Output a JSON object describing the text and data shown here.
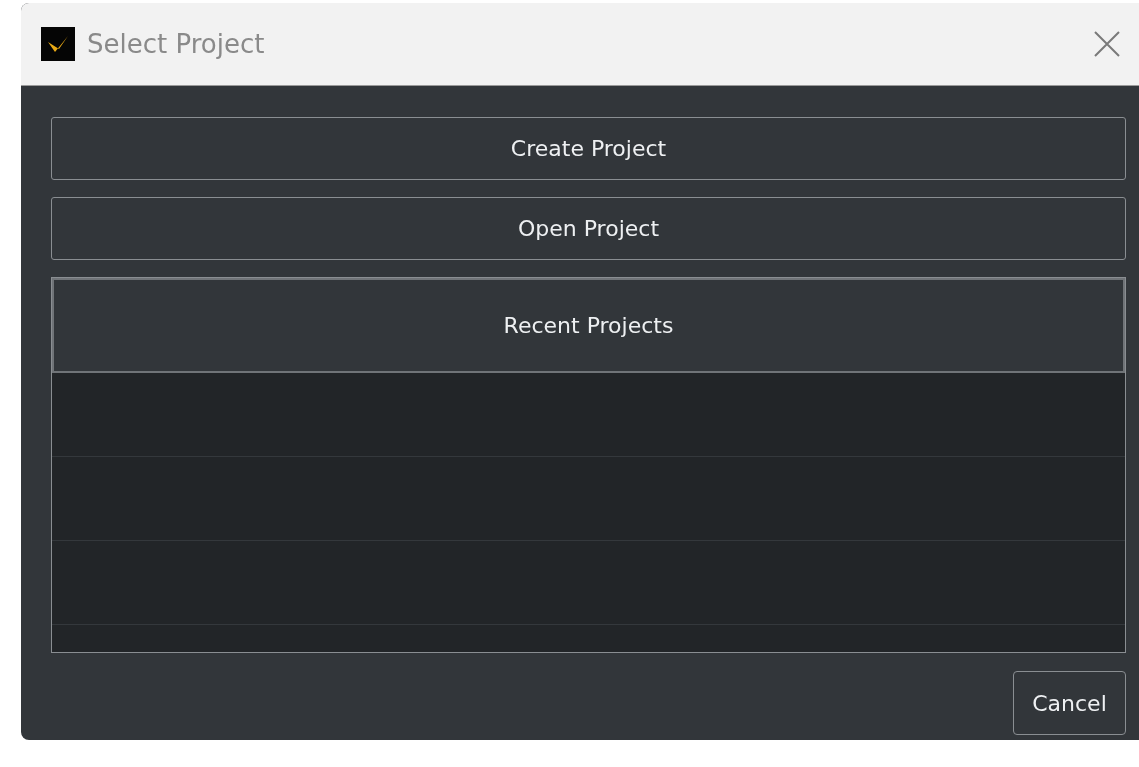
{
  "window": {
    "title": "Select Project"
  },
  "actions": [
    {
      "label": "Create Project"
    },
    {
      "label": "Open Project"
    }
  ],
  "recent_projects": {
    "header": "Recent Projects"
  },
  "footer": {
    "cancel": "Cancel"
  }
}
